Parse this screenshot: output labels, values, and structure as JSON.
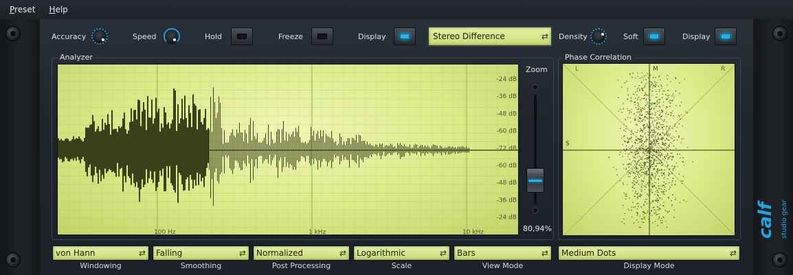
{
  "menu": [
    {
      "label": "Preset",
      "accel": "P",
      "rest": "reset"
    },
    {
      "label": "Help",
      "accel": "H",
      "rest": "elp"
    }
  ],
  "top_controls": {
    "accuracy_label": "Accuracy",
    "speed_label": "Speed",
    "hold_label": "Hold",
    "hold_on": false,
    "freeze_label": "Freeze",
    "freeze_on": false,
    "display_label": "Display",
    "display_on": true,
    "mode_select": "Stereo Difference",
    "density_label": "Density",
    "soft_label": "Soft",
    "soft_on": true,
    "display2_label": "Display",
    "display2_on": true
  },
  "analyzer": {
    "title": "Analyzer",
    "db_labels": [
      "-24 dB",
      "-36 dB",
      "-48 dB",
      "-60 dB",
      "-72 dB",
      "-60 dB",
      "-48 dB",
      "-36 dB",
      "-24 dB"
    ],
    "freq_labels": [
      "100 Hz",
      "1 kHz",
      "10 kHz"
    ],
    "zoom_label": "Zoom",
    "zoom_value": "80,94%"
  },
  "phase": {
    "title": "Phase Correlation",
    "corner_l": "L",
    "corner_m": "M",
    "corner_r": "R",
    "side_s": "S"
  },
  "bottom": {
    "windowing": {
      "value": "von Hann",
      "label": "Windowing"
    },
    "smoothing": {
      "value": "Falling",
      "label": "Smoothing"
    },
    "post": {
      "value": "Normalized",
      "label": "Post Processing"
    },
    "scale": {
      "value": "Logarithmic",
      "label": "Scale"
    },
    "view": {
      "value": "Bars",
      "label": "View Mode"
    },
    "display_mode": {
      "value": "Medium Dots",
      "label": "Display Mode"
    }
  },
  "brand": {
    "logo": "calf",
    "sub": "studio gear"
  },
  "colors": {
    "screen": "#dbe987",
    "led": "#1fb6f0",
    "trace": "#3b3f1a"
  }
}
